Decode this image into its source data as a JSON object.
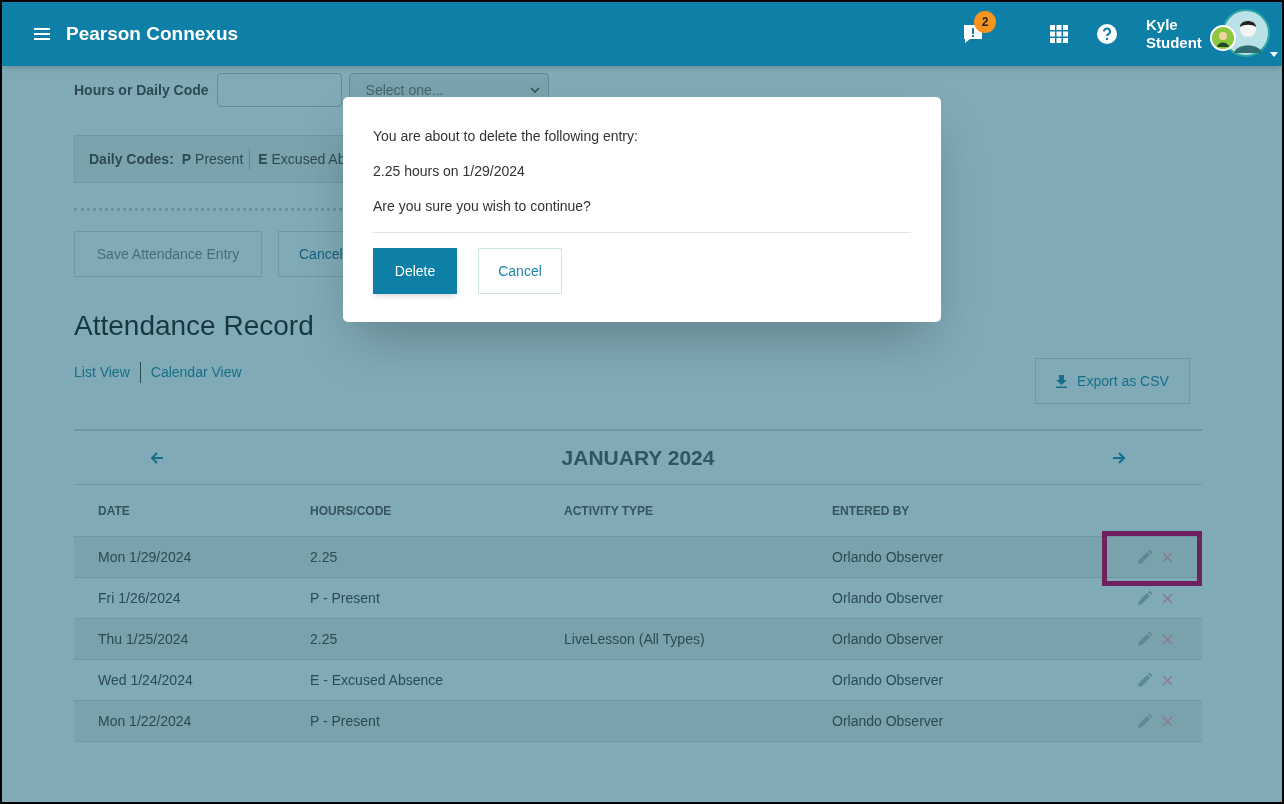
{
  "header": {
    "title": "Pearson Connexus",
    "notification_count": "2",
    "user_name": "Kyle Student"
  },
  "form": {
    "hours_label": "Hours or Daily Code",
    "select_placeholder": "Select one...",
    "daily_codes_label": "Daily Codes:",
    "daily_codes": [
      {
        "code": "P",
        "label": "Present"
      },
      {
        "code": "E",
        "label": "Excused Ab"
      }
    ],
    "save_button": {
      "label": "Save Attendance Entry",
      "disabled": true
    },
    "cancel_button": "Cancel"
  },
  "attendance": {
    "title": "Attendance Record",
    "views": [
      {
        "label": "List View"
      },
      {
        "label": "Calendar View"
      }
    ],
    "export_button": "Export as CSV",
    "month": "JANUARY 2024",
    "table": {
      "columns": [
        "DATE",
        "HOURS/CODE",
        "ACTIVITY TYPE",
        "ENTERED BY"
      ],
      "rows": [
        {
          "date": "Mon 1/29/2024",
          "hours": "2.25",
          "entered_by": "Orlando Observer",
          "highlighted": true
        },
        {
          "date": "Fri 1/26/2024",
          "hours": "P - Present",
          "entered_by": "Orlando Observer",
          "highlighted": false
        },
        {
          "date": "Thu 1/25/2024",
          "hours": "2.25",
          "activity": "LiveLesson (All Types)",
          "entered_by": "Orlando Observer",
          "highlighted": false
        },
        {
          "date": "Wed 1/24/2024",
          "hours": "E - Excused Absence",
          "entered_by": "Orlando Observer",
          "highlighted": false
        },
        {
          "date": "Mon 1/22/2024",
          "hours": "P - Present",
          "entered_by": "Orlando Observer",
          "highlighted": false
        }
      ]
    }
  },
  "dialog": {
    "lines": [
      "You are about to delete the following entry:",
      "2.25 hours on 1/29/2024",
      "Are you sure you wish to continue?"
    ],
    "buttons": [
      {
        "label": "Delete",
        "kind": "primary"
      },
      {
        "label": "Cancel",
        "kind": "secondary"
      }
    ]
  }
}
